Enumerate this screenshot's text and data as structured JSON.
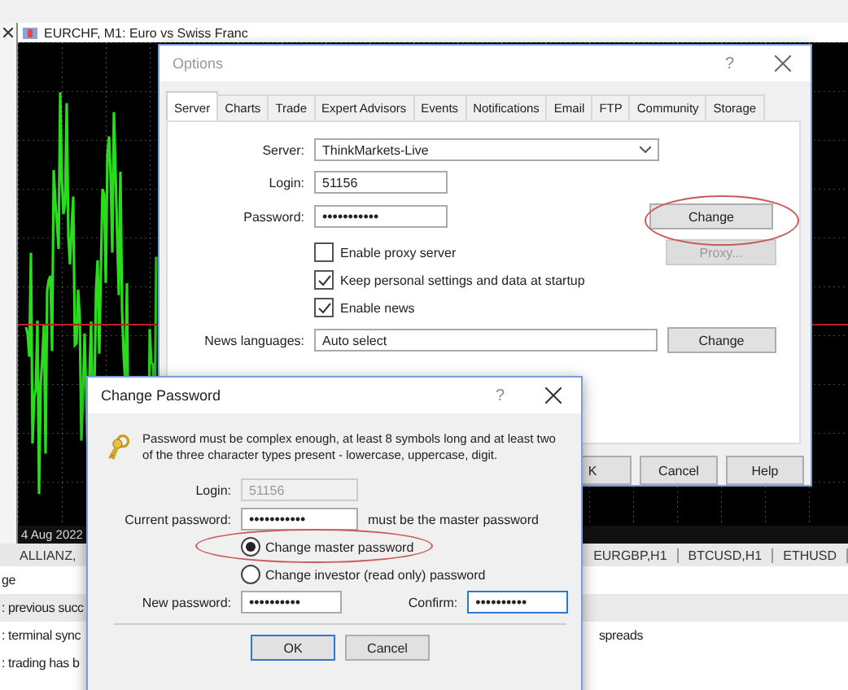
{
  "chart_window": {
    "title": "EURCHF, M1:  Euro vs Swiss Franc",
    "date_label": "4 Aug 2022"
  },
  "chart_tabs": [
    {
      "label": "ALLIANZ,"
    },
    {
      "label": "EURGBP,H1"
    },
    {
      "label": "BTCUSD,H1"
    },
    {
      "label": "ETHUSD"
    }
  ],
  "journal": [
    {
      "text": "ge"
    },
    {
      "text": ": previous succ"
    },
    {
      "text": ": terminal sync",
      "end": "spreads"
    },
    {
      "text": ": trading has b"
    }
  ],
  "options": {
    "title": "Options",
    "help_glyph": "?",
    "tabs": [
      {
        "label": "Server",
        "selected": true
      },
      {
        "label": "Charts",
        "selected": false
      },
      {
        "label": "Trade",
        "selected": false
      },
      {
        "label": "Expert Advisors",
        "selected": false
      },
      {
        "label": "Events",
        "selected": false
      },
      {
        "label": "Notifications",
        "selected": false
      },
      {
        "label": "Email",
        "selected": false
      },
      {
        "label": "FTP",
        "selected": false
      },
      {
        "label": "Community",
        "selected": false
      },
      {
        "label": "Storage",
        "selected": false
      }
    ],
    "server_label": "Server:",
    "server": "ThinkMarkets-Live",
    "login_label": "Login:",
    "login": "51156",
    "password_label": "Password:",
    "password": "•••••••••••",
    "change_label": "Change",
    "checkboxes": [
      {
        "label": "Enable proxy server",
        "checked": false
      },
      {
        "label": "Keep personal settings and data at startup",
        "checked": true
      },
      {
        "label": "Enable news",
        "checked": true
      }
    ],
    "proxy_button": {
      "label": "Proxy...",
      "disabled": true
    },
    "news_label": "News languages:",
    "news": "Auto select",
    "news_change_label": "Change",
    "buttons": [
      "K",
      "Cancel",
      "Help"
    ]
  },
  "change_password": {
    "title": "Change Password",
    "help_glyph": "?",
    "message": "Password must be complex enough, at least 8 symbols long and at least two of the three character types present - lowercase, uppercase, digit.",
    "login_label": "Login:",
    "login": "51156",
    "current_label": "Current password:",
    "current": "•••••••••••",
    "current_hint": "must be the master password",
    "radios": [
      {
        "label": "Change master password",
        "selected": true
      },
      {
        "label": "Change investor (read only) password",
        "selected": false
      }
    ],
    "new_label": "New password:",
    "new": "••••••••••",
    "confirm_label": "Confirm:",
    "confirm": "••••••••••",
    "buttons": [
      "OK",
      "Cancel"
    ]
  }
}
